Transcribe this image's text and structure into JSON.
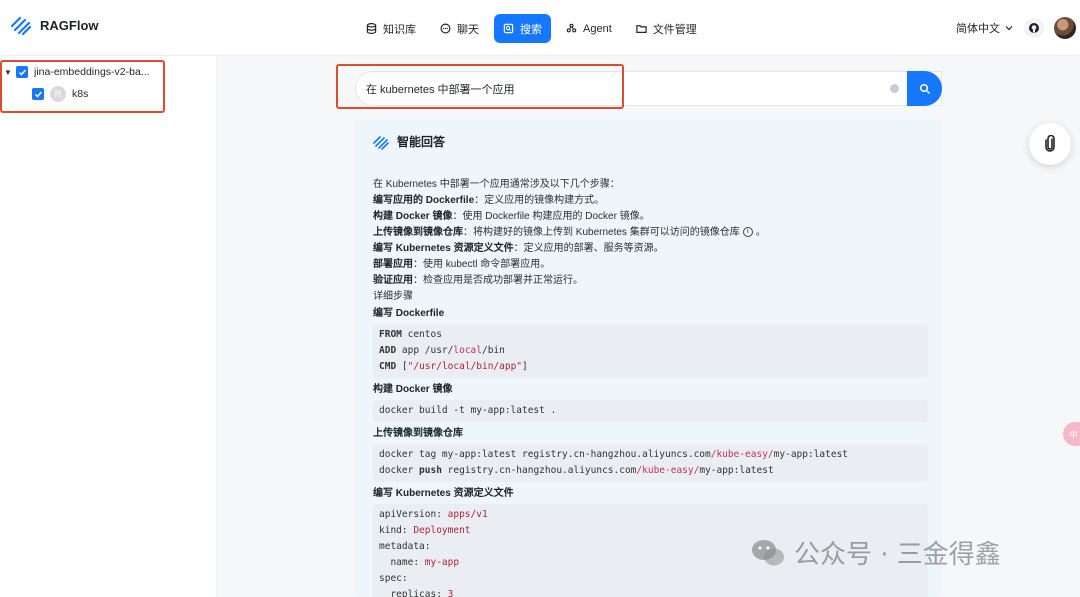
{
  "app": {
    "name": "RAGFlow"
  },
  "nav": [
    {
      "label": "知识库",
      "icon": "database-icon",
      "active": false
    },
    {
      "label": "聊天",
      "icon": "chat-icon",
      "active": false
    },
    {
      "label": "搜索",
      "icon": "search-icon",
      "active": true
    },
    {
      "label": "Agent",
      "icon": "agent-icon",
      "active": false
    },
    {
      "label": "文件管理",
      "icon": "folder-icon",
      "active": false
    }
  ],
  "header": {
    "language": "简体中文"
  },
  "sidebar": {
    "knowledge_base": "jina-embeddings-v2-ba...",
    "member": "k8s",
    "member_initial": "R"
  },
  "search": {
    "query": "在 kubernetes 中部署一个应用"
  },
  "answer": {
    "title": "智能回答",
    "intro": "在 Kubernetes 中部署一个应用通常涉及以下几个步骤：",
    "steps": [
      {
        "b": "编写应用的 Dockerfile",
        "t": "：定义应用的镜像构建方式。"
      },
      {
        "b": "构建 Docker 镜像",
        "t": "：使用 Dockerfile 构建应用的 Docker 镜像。"
      },
      {
        "b": "上传镜像到镜像仓库",
        "t": "：将构建好的镜像上传到 Kubernetes 集群可以访问的镜像仓库"
      },
      {
        "b": "编写 Kubernetes 资源定义文件",
        "t": "：定义应用的部署、服务等资源。"
      },
      {
        "b": "部署应用",
        "t": "：使用 kubectl 命令部署应用。"
      },
      {
        "b": "验证应用",
        "t": "：检查应用是否成功部署并正常运行。"
      }
    ],
    "details_label": "详细步骤",
    "sec1": "编写 Dockerfile",
    "sec2": "构建 Docker 镜像",
    "sec3": "上传镜像到镜像仓库",
    "sec4": "编写 Kubernetes 资源定义文件",
    "code_build": "docker build -t my-app:latest .",
    "code_tag_1": "docker tag my-app:latest registry.cn-hangzhou.aliyuncs.com",
    "code_tag_2": "/kube-easy/",
    "code_tag_3": "my-app:latest",
    "code_push_1": "docker ",
    "code_push_2": "push",
    "code_push_3": " registry.cn-hangzhou.aliyuncs.com",
    "code_push_4": "/kube-easy/",
    "code_push_5": "my-app:latest"
  },
  "watermark": "公众号 · 三金得鑫",
  "edge_bubble": "中",
  "colors": {
    "accent": "#1677ff",
    "highlight_box": "#e04a2f",
    "answer_bg": "#eef5fb"
  }
}
